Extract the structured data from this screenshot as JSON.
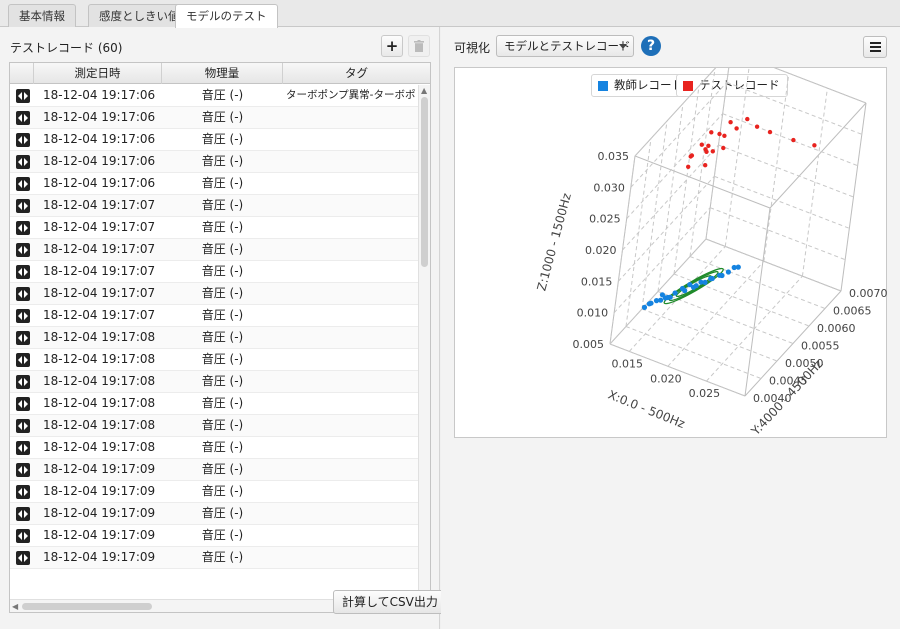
{
  "tabs": [
    {
      "label": "基本情報",
      "active": false
    },
    {
      "label": "感度としきい値",
      "active": false
    },
    {
      "label": "モデルのテスト",
      "active": true
    }
  ],
  "left": {
    "title": "テストレコード (60)",
    "columns": [
      "測定日時",
      "物理量",
      "タグ"
    ],
    "rows": [
      {
        "datetime": "18-12-04  19:17:06",
        "quantity": "音圧 (-)",
        "tag": "ターボポンプ異常-ターボポンプ異"
      },
      {
        "datetime": "18-12-04  19:17:06",
        "quantity": "音圧 (-)",
        "tag": ""
      },
      {
        "datetime": "18-12-04  19:17:06",
        "quantity": "音圧 (-)",
        "tag": ""
      },
      {
        "datetime": "18-12-04  19:17:06",
        "quantity": "音圧 (-)",
        "tag": ""
      },
      {
        "datetime": "18-12-04  19:17:06",
        "quantity": "音圧 (-)",
        "tag": ""
      },
      {
        "datetime": "18-12-04  19:17:07",
        "quantity": "音圧 (-)",
        "tag": ""
      },
      {
        "datetime": "18-12-04  19:17:07",
        "quantity": "音圧 (-)",
        "tag": ""
      },
      {
        "datetime": "18-12-04  19:17:07",
        "quantity": "音圧 (-)",
        "tag": ""
      },
      {
        "datetime": "18-12-04  19:17:07",
        "quantity": "音圧 (-)",
        "tag": ""
      },
      {
        "datetime": "18-12-04  19:17:07",
        "quantity": "音圧 (-)",
        "tag": ""
      },
      {
        "datetime": "18-12-04  19:17:07",
        "quantity": "音圧 (-)",
        "tag": ""
      },
      {
        "datetime": "18-12-04  19:17:08",
        "quantity": "音圧 (-)",
        "tag": ""
      },
      {
        "datetime": "18-12-04  19:17:08",
        "quantity": "音圧 (-)",
        "tag": ""
      },
      {
        "datetime": "18-12-04  19:17:08",
        "quantity": "音圧 (-)",
        "tag": ""
      },
      {
        "datetime": "18-12-04  19:17:08",
        "quantity": "音圧 (-)",
        "tag": ""
      },
      {
        "datetime": "18-12-04  19:17:08",
        "quantity": "音圧 (-)",
        "tag": ""
      },
      {
        "datetime": "18-12-04  19:17:08",
        "quantity": "音圧 (-)",
        "tag": ""
      },
      {
        "datetime": "18-12-04  19:17:09",
        "quantity": "音圧 (-)",
        "tag": ""
      },
      {
        "datetime": "18-12-04  19:17:09",
        "quantity": "音圧 (-)",
        "tag": ""
      },
      {
        "datetime": "18-12-04  19:17:09",
        "quantity": "音圧 (-)",
        "tag": ""
      },
      {
        "datetime": "18-12-04  19:17:09",
        "quantity": "音圧 (-)",
        "tag": ""
      },
      {
        "datetime": "18-12-04  19:17:09",
        "quantity": "音圧 (-)",
        "tag": ""
      }
    ],
    "csv_button": "計算してCSV出力"
  },
  "right": {
    "vis_label": "可視化",
    "select_value": "モデルとテストレコード",
    "help": "?"
  },
  "colors": {
    "teacher": "#1583e0",
    "test": "#e8231f",
    "model": "#1f8a2a"
  },
  "chart_data": {
    "type": "scatter",
    "legend": [
      "教師レコード",
      "テストレコード"
    ],
    "legend_position": "top",
    "grid": true,
    "axes": {
      "x": {
        "label": "X:0.0 - 500Hz",
        "range": [
          0.0125,
          0.03
        ],
        "ticks": [
          "0.015",
          "0.020",
          "0.025"
        ]
      },
      "y": {
        "label": "Y:4000 - 4500Hz",
        "range": [
          0.004,
          0.007
        ],
        "ticks": [
          "0.0040",
          "0.0045",
          "0.0050",
          "0.0055",
          "0.0060",
          "0.0065",
          "0.0070"
        ]
      },
      "z": {
        "label": "Z:1000 - 1500Hz",
        "range": [
          0.005,
          0.035
        ],
        "ticks": [
          "0.005",
          "0.010",
          "0.015",
          "0.020",
          "0.025",
          "0.030",
          "0.035"
        ]
      }
    },
    "series": [
      {
        "name": "教師レコード",
        "points": [
          [
            0.0152,
            0.0045,
            0.01
          ],
          [
            0.016,
            0.0046,
            0.0103
          ],
          [
            0.0158,
            0.0047,
            0.0105
          ],
          [
            0.017,
            0.0048,
            0.0108
          ],
          [
            0.0175,
            0.0049,
            0.0112
          ],
          [
            0.018,
            0.005,
            0.0115
          ],
          [
            0.019,
            0.0051,
            0.0118
          ],
          [
            0.0198,
            0.0052,
            0.0122
          ],
          [
            0.0205,
            0.0053,
            0.0125
          ],
          [
            0.0212,
            0.0054,
            0.0128
          ],
          [
            0.015,
            0.0045,
            0.0098
          ],
          [
            0.0155,
            0.0046,
            0.01
          ],
          [
            0.0162,
            0.0047,
            0.0102
          ],
          [
            0.0168,
            0.0047,
            0.0106
          ],
          [
            0.0185,
            0.005,
            0.0113
          ],
          [
            0.0195,
            0.0051,
            0.012
          ],
          [
            0.02,
            0.0052,
            0.0123
          ],
          [
            0.0215,
            0.0055,
            0.0131
          ],
          [
            0.022,
            0.0055,
            0.0134
          ],
          [
            0.0148,
            0.0044,
            0.0097
          ],
          [
            0.0165,
            0.0047,
            0.0104
          ],
          [
            0.0178,
            0.0049,
            0.011
          ],
          [
            0.0188,
            0.005,
            0.0117
          ],
          [
            0.0208,
            0.0053,
            0.0126
          ]
        ]
      },
      {
        "name": "テストレコード",
        "points": [
          [
            0.016,
            0.005,
            0.031
          ],
          [
            0.0165,
            0.0052,
            0.032
          ],
          [
            0.017,
            0.0053,
            0.0315
          ],
          [
            0.0158,
            0.0051,
            0.0305
          ],
          [
            0.0175,
            0.0055,
            0.0325
          ],
          [
            0.0168,
            0.0054,
            0.033
          ],
          [
            0.0172,
            0.0052,
            0.0312
          ],
          [
            0.018,
            0.0057,
            0.0335
          ],
          [
            0.0162,
            0.0049,
            0.03
          ],
          [
            0.0178,
            0.0056,
            0.0318
          ],
          [
            0.0185,
            0.0058,
            0.0322
          ],
          [
            0.019,
            0.006,
            0.0328
          ],
          [
            0.021,
            0.0063,
            0.03
          ],
          [
            0.023,
            0.0066,
            0.028
          ],
          [
            0.025,
            0.0068,
            0.027
          ],
          [
            0.0167,
            0.0053,
            0.0308
          ],
          [
            0.0173,
            0.0054,
            0.0302
          ],
          [
            0.0176,
            0.0051,
            0.0298
          ],
          [
            0.0182,
            0.0055,
            0.0306
          ],
          [
            0.02,
            0.0061,
            0.0315
          ]
        ]
      }
    ]
  }
}
